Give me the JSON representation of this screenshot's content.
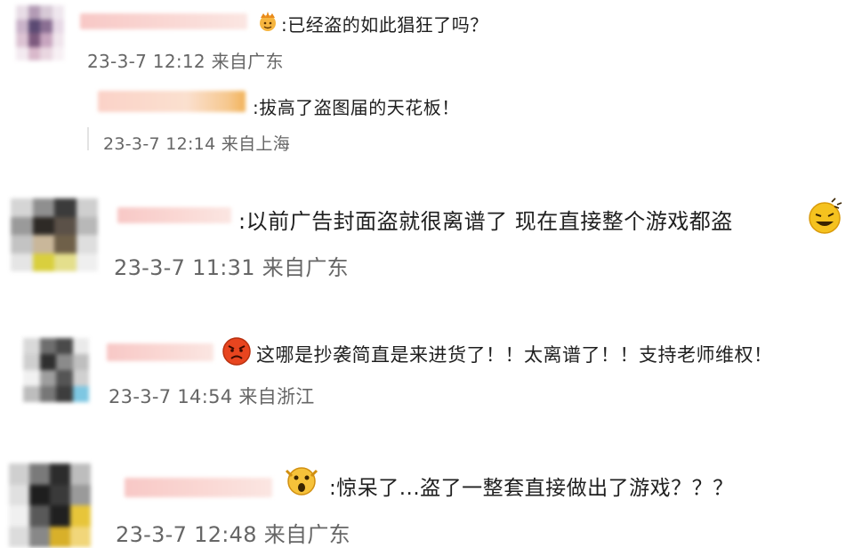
{
  "comments": [
    {
      "text": ":已经盗的如此猖狂了吗？",
      "meta": "23-3-7 12:12 来自广东"
    },
    {
      "text": ":拔高了盗图届的天花板！",
      "meta": "23-3-7 12:14 来自上海"
    },
    {
      "text": ":以前广告封面盗就很离谱了 现在直接整个游戏都盗",
      "meta": "23-3-7 11:31 来自广东"
    },
    {
      "text": "这哪是抄袭简直是来进货了！！太离谱了！！支持老师维权！",
      "meta": "23-3-7 14:54 来自浙江"
    },
    {
      "text": ":惊呆了...盗了一整套直接做出了游戏？？？",
      "meta": "23-3-7 12:48 来自广东"
    }
  ],
  "colors": {
    "text": "#1f1f1f",
    "meta": "#666666",
    "name_blur": "#f8c8c6"
  },
  "icons": [
    "crown-emoji-icon",
    "grin-emoji-icon",
    "angry-emoji-icon",
    "surprised-emoji-icon"
  ]
}
